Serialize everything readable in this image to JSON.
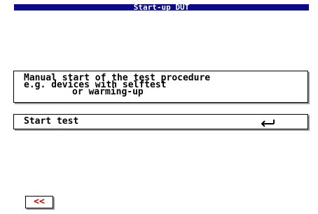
{
  "header": {
    "title": "Start-up DUT"
  },
  "info": {
    "lines": [
      "Manual start of the test procedure",
      "e.g. devices with selftest",
      "or warming-up"
    ]
  },
  "start_test": {
    "label": "Start test",
    "icon": "enter-icon"
  },
  "back_button": {
    "label": "<<",
    "color": "#d40000"
  },
  "colors": {
    "title_bar": "#0a0a8a",
    "title_text": "#ffffff",
    "background": "#ffffff"
  }
}
